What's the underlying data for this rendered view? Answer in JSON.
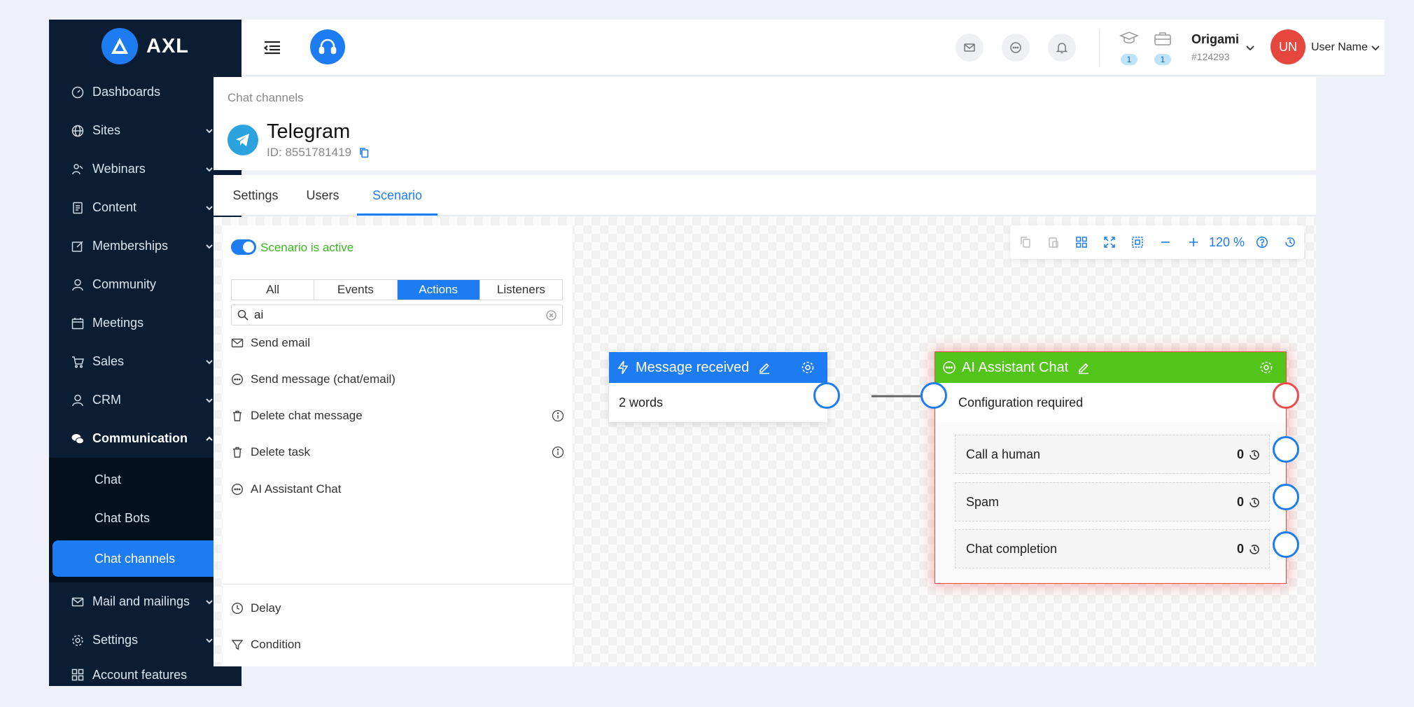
{
  "brand": {
    "name": "AXL"
  },
  "sidebar": {
    "items": [
      {
        "label": "Dashboards"
      },
      {
        "label": "Sites"
      },
      {
        "label": "Webinars"
      },
      {
        "label": "Content"
      },
      {
        "label": "Memberships"
      },
      {
        "label": "Community"
      },
      {
        "label": "Meetings"
      },
      {
        "label": "Sales"
      },
      {
        "label": "CRM"
      },
      {
        "label": "Communication"
      },
      {
        "label": "Mail and mailings"
      },
      {
        "label": "Settings"
      },
      {
        "label": "Account features"
      }
    ],
    "sub_items": [
      {
        "label": "Chat"
      },
      {
        "label": "Chat Bots"
      },
      {
        "label": "Chat channels"
      }
    ]
  },
  "topbar": {
    "stats": [
      {
        "count": "1"
      },
      {
        "count": "1"
      }
    ],
    "org": {
      "name": "Origami",
      "id": "#124293"
    },
    "user": {
      "initials": "UN",
      "name": "User Name"
    }
  },
  "header": {
    "breadcrumb": "Chat channels",
    "title": "Telegram",
    "channel_id": "ID: 8551781419"
  },
  "tabs": [
    {
      "label": "Settings"
    },
    {
      "label": "Users"
    },
    {
      "label": "Scenario"
    }
  ],
  "panel": {
    "status": "Scenario is active",
    "filters": [
      {
        "label": "All"
      },
      {
        "label": "Events"
      },
      {
        "label": "Actions"
      },
      {
        "label": "Listeners"
      }
    ],
    "search_value": "ai",
    "actions": [
      {
        "label": "Send email"
      },
      {
        "label": "Send message (chat/email)"
      },
      {
        "label": "Delete chat message"
      },
      {
        "label": "Delete task"
      },
      {
        "label": "AI Assistant Chat"
      }
    ],
    "extras": [
      {
        "label": "Delay"
      },
      {
        "label": "Condition"
      }
    ]
  },
  "toolbar": {
    "zoom": "120 %"
  },
  "nodes": {
    "trigger": {
      "title": "Message received",
      "body": "2 words"
    },
    "ai": {
      "title": "AI Assistant Chat",
      "status": "Configuration required",
      "outputs": [
        {
          "label": "Call a human",
          "count": "0"
        },
        {
          "label": "Spam",
          "count": "0"
        },
        {
          "label": "Chat completion",
          "count": "0"
        }
      ]
    }
  },
  "colors": {
    "accent": "#1d7cf2",
    "sidebar": "#0b1d33",
    "success": "#3cb71e",
    "action_node": "#52c41a",
    "danger": "#ef4b4b"
  }
}
